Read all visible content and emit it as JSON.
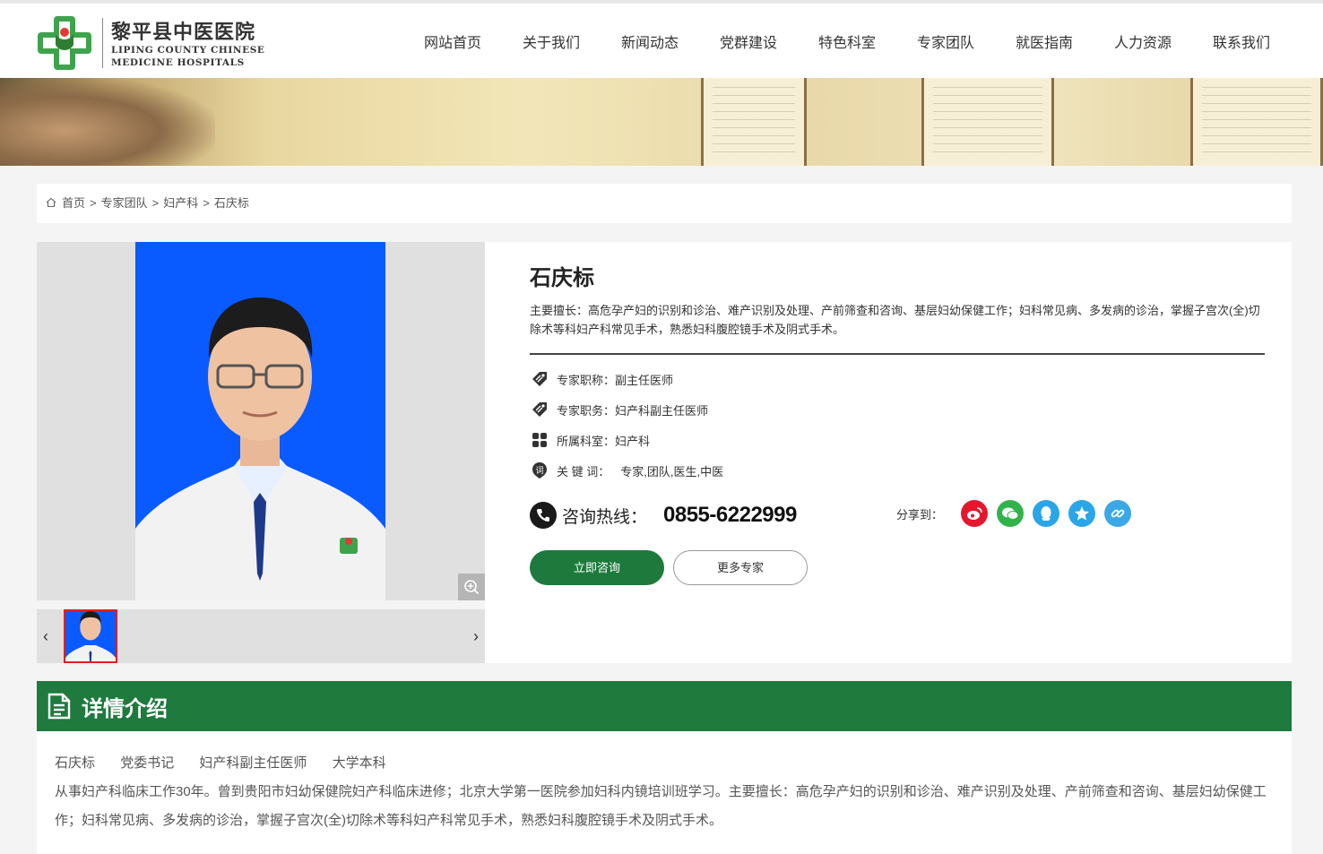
{
  "header": {
    "logo_cn": "黎平县中医医院",
    "logo_en_line1": "LIPING COUNTY CHINESE",
    "logo_en_line2": "MEDICINE HOSPITALS",
    "nav": [
      "网站首页",
      "关于我们",
      "新闻动态",
      "党群建设",
      "特色科室",
      "专家团队",
      "就医指南",
      "人力资源",
      "联系我们"
    ]
  },
  "breadcrumb": {
    "home": "首页",
    "sep1": ">",
    "team": "专家团队",
    "sep2": ">",
    "dept": "妇产科",
    "sep3": ">",
    "current": "石庆标"
  },
  "doctor": {
    "name": "石庆标",
    "specialty": "主要擅长：高危孕产妇的识别和诊治、难产识别及处理、产前筛查和咨询、基层妇幼保健工作；妇科常见病、多发病的诊治，掌握子宫次(全)切除术等科妇产科常见手术，熟悉妇科腹腔镜手术及阴式手术。",
    "title_label": "专家职称：",
    "title_value": "副主任医师",
    "position_label": "专家职务：",
    "position_value": "妇产科副主任医师",
    "dept_label": "所属科室：",
    "dept_value": "妇产科",
    "keywords_label": "关 键 词：",
    "keywords_value": "专家,团队,医生,中医"
  },
  "contact": {
    "hotline_label": "咨询热线：",
    "hotline_number": "0855-6222999",
    "share_label": "分享到：",
    "share_icons": [
      "weibo-icon",
      "wechat-icon",
      "qq-icon",
      "qzone-icon",
      "link-icon"
    ],
    "share_colors": [
      "#e6162d",
      "#2fb44a",
      "#2aa6e8",
      "#2aa6e8",
      "#3aa7e6"
    ]
  },
  "buttons": {
    "consult": "立即咨询",
    "more": "更多专家"
  },
  "detail": {
    "heading": "详情介绍",
    "tags": [
      "石庆标",
      "党委书记",
      "妇产科副主任医师",
      "大学本科"
    ],
    "body": "从事妇产科临床工作30年。曾到贵阳市妇幼保健院妇产科临床进修；北京大学第一医院参加妇科内镜培训班学习。主要擅长：高危孕产妇的识别和诊治、难产识别及处理、产前筛查和咨询、基层妇幼保健工作；妇科常见病、多发病的诊治，掌握子宫次(全)切除术等科妇产科常见手术，熟悉妇科腹腔镜手术及阴式手术。"
  },
  "colors": {
    "brand_green": "#1f7a3e",
    "photo_bg": "#0a5bff"
  }
}
